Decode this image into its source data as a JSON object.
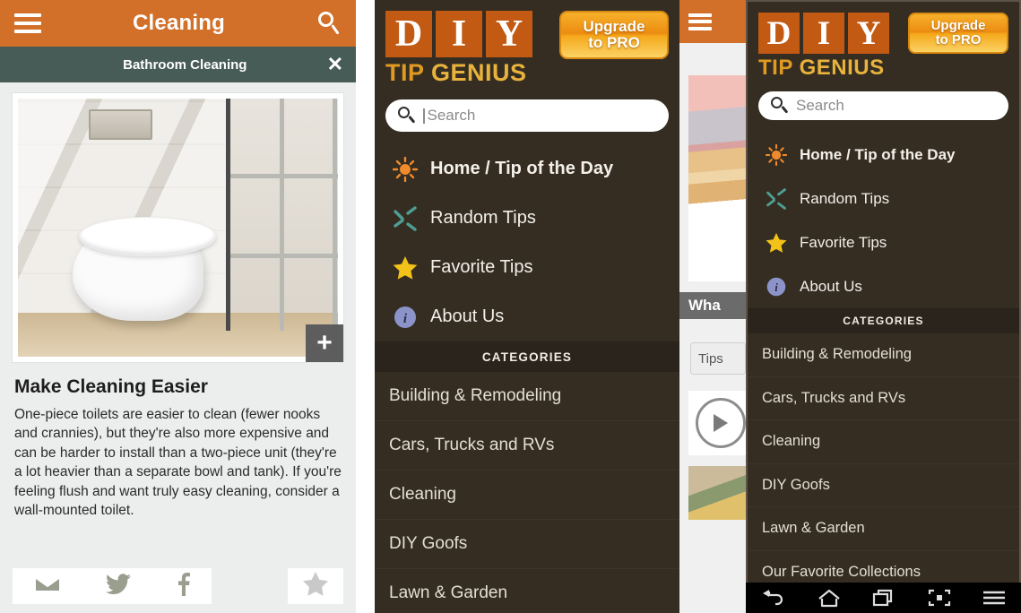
{
  "panel1": {
    "header": {
      "title": "Cleaning",
      "menu_icon": "hamburger-icon",
      "search_icon": "search-icon"
    },
    "subheader": {
      "title": "Bathroom Cleaning",
      "close_icon": "close-icon"
    },
    "image": {
      "alt": "Wall-mounted toilet in tiled bathroom",
      "zoom_badge": "+"
    },
    "article": {
      "title": "Make Cleaning Easier",
      "body": "One-piece toilets are easier to clean (fewer nooks and crannies), but they're also more expensive and can be harder to install than a two-piece unit (they're a lot heavier than a separate bowl and tank). If you're feeling flush and want truly easy cleaning, consider a wall-mounted toilet."
    },
    "share": {
      "email_icon": "email-icon",
      "twitter_icon": "twitter-icon",
      "facebook_icon": "facebook-icon",
      "favorite_icon": "star-icon"
    }
  },
  "peek": {
    "menu_icon": "hamburger-icon",
    "banner_text": "Wha",
    "button_label": "Tips",
    "video_icon": "play-icon"
  },
  "sidebar": {
    "logo": {
      "letters": [
        "D",
        "I",
        "Y"
      ],
      "subtitle_first": "TIP",
      "subtitle_second": "GENIUS"
    },
    "pro_button": {
      "line1": "Upgrade",
      "line2": "to PRO"
    },
    "search": {
      "placeholder": "Search",
      "icon": "search-icon"
    },
    "nav": [
      {
        "label": "Home / Tip of the Day",
        "icon": "sun-icon"
      },
      {
        "label": "Random Tips",
        "icon": "shuffle-icon"
      },
      {
        "label": "Favorite Tips",
        "icon": "star-icon"
      },
      {
        "label": "About Us",
        "icon": "info-icon"
      }
    ],
    "categories_header": "CATEGORIES",
    "categories": [
      "Building & Remodeling",
      "Cars, Trucks and RVs",
      "Cleaning",
      "DIY Goofs",
      "Lawn & Garden"
    ],
    "categories_full": [
      "Building & Remodeling",
      "Cars, Trucks and RVs",
      "Cleaning",
      "DIY Goofs",
      "Lawn & Garden",
      "Our Favorite Collections"
    ]
  },
  "android_nav": [
    {
      "icon": "back-icon"
    },
    {
      "icon": "home-icon"
    },
    {
      "icon": "recent-apps-icon"
    },
    {
      "icon": "screenshot-icon"
    },
    {
      "icon": "menu-icon"
    }
  ],
  "colors": {
    "orange_header": "#d2702a",
    "sub_header": "#475c56",
    "sidebar_bg": "#352d22",
    "categories_bg": "#2b241c",
    "logo_orange": "#c35a13",
    "logo_gold": "#e8b33c",
    "sun_icon": "#ef8b2c",
    "shuffle_icon": "#4f9e93",
    "star_icon": "#f2c218",
    "info_icon": "#8b93c9"
  }
}
